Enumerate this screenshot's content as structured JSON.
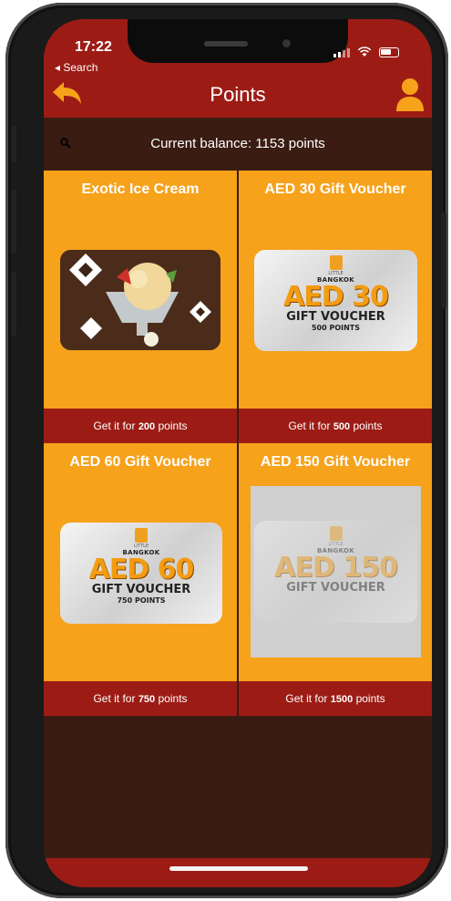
{
  "status": {
    "time": "17:22",
    "back_label": "◂ Search"
  },
  "nav": {
    "title": "Points"
  },
  "balance": {
    "text": "Current balance: 1153 points"
  },
  "rewards": [
    {
      "title": "Exotic Ice Cream",
      "footer_prefix": "Get it for ",
      "points": "200",
      "footer_suffix": " points"
    },
    {
      "title": "AED 30 Gift Voucher",
      "footer_prefix": "Get it for ",
      "points": "500",
      "footer_suffix": " points",
      "voucher": {
        "little": "LITTLE",
        "brand": "BANGKOK",
        "amount": "AED 30",
        "gift": "GIFT VOUCHER",
        "points": "500 POINTS"
      }
    },
    {
      "title": "AED 60 Gift Voucher",
      "footer_prefix": "Get it for ",
      "points": "750",
      "footer_suffix": " points",
      "voucher": {
        "little": "LITTLE",
        "brand": "BANGKOK",
        "amount": "AED 60",
        "gift": "GIFT VOUCHER",
        "points": "750 POINTS"
      }
    },
    {
      "title": "AED 150 Gift Voucher",
      "footer_prefix": "Get it for ",
      "points": "1500",
      "footer_suffix": " points",
      "voucher": {
        "little": "LITTLE",
        "brand": "BANGKOK",
        "amount": "AED 150",
        "gift": "GIFT VOUCHER"
      }
    }
  ],
  "colors": {
    "header_red": "#9c1c15",
    "card_orange": "#f6a21b",
    "background_brown": "#3a1c12"
  },
  "icons": {
    "back": "back-arrow-icon",
    "user": "user-profile-icon",
    "search": "search-icon"
  }
}
